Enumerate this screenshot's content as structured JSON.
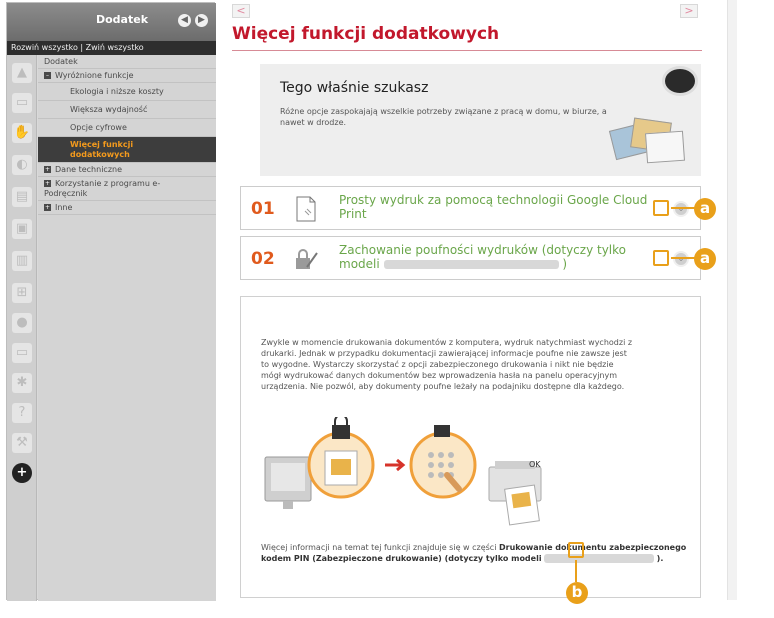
{
  "sidebar": {
    "title": "Dodatek",
    "prev_arrow": "◀",
    "next_arrow": "▶",
    "expand_collapse": "Rozwiń wszystko | Zwiń wszystko",
    "add_icon": "+",
    "icons": [
      "warning-icon",
      "printer-icon",
      "hand-icon",
      "fax-icon",
      "scanner-icon",
      "copier-icon",
      "device-icon",
      "network-icon",
      "lock-icon",
      "monitor-icon",
      "settings-icon",
      "help-icon",
      "wrench-icon",
      "plus-icon"
    ],
    "tree": [
      {
        "label": "Dodatek",
        "level": 0
      },
      {
        "label": "Wyróżnione funkcje",
        "level": 1,
        "toggle": "■"
      },
      {
        "label": "Ekologia i niższe koszty",
        "level": 2
      },
      {
        "label": "Większa wydajność",
        "level": 2
      },
      {
        "label": "Opcje cyfrowe",
        "level": 2
      },
      {
        "label": "Więcej funkcji dodatkowych",
        "level": 2,
        "selected": true
      },
      {
        "label": "Dane techniczne",
        "level": 1,
        "toggle": "■"
      },
      {
        "label": "Korzystanie z programu e-Podręcznik",
        "level": 1,
        "toggle": "■"
      },
      {
        "label": "Inne",
        "level": 1,
        "toggle": "■"
      }
    ]
  },
  "nav": {
    "prev": "<",
    "next": ">"
  },
  "page_title": "Więcej funkcji dodatkowych",
  "hero": {
    "heading": "Tego właśnie szukasz",
    "description": "Różne opcje zaspokajają wszelkie potrzeby związane z pracą w domu, w biurze, a nawet w drodze."
  },
  "features": [
    {
      "number": "01",
      "text": "Prosty wydruk za pomocą technologii Google Cloud Print",
      "icon": "document-icon",
      "toggle": "⌄"
    },
    {
      "number": "02",
      "text_before": "Zachowanie poufności wydruków (dotyczy tylko modeli",
      "text_after": ")",
      "icon": "lock-pen-icon",
      "toggle": "⌄"
    }
  ],
  "detail": {
    "body": "Zwykle w momencie drukowania dokumentów z komputera, wydruk natychmiast wychodzi z drukarki. Jednak w przypadku dokumentacji zawierającej informacje poufne nie zawsze jest to wygodne. Wystarczy skorzystać z opcji zabezpieczonego drukowania i nikt nie będzie mógł wydrukować danych dokumentów bez wprowadzenia hasła na panelu operacyjnym urządzenia. Nie pozwól, aby dokumenty poufne leżały na podajniku dostępne dla każdego.",
    "ok_label": "OK",
    "footer_intro": "Więcej informacji na temat tej funkcji znajduje się w części",
    "footer_link": "Drukowanie dokumentu zabezpieczonego kodem PIN (Zabezpieczone drukowanie) (dotyczy tylko modeli",
    "footer_end": ")."
  },
  "callouts": {
    "a": "a",
    "b": "b"
  },
  "colors": {
    "accent_red": "#c2182c",
    "orange": "#e05a1d",
    "link_green": "#6aa64a",
    "callout": "#e9a01a"
  }
}
